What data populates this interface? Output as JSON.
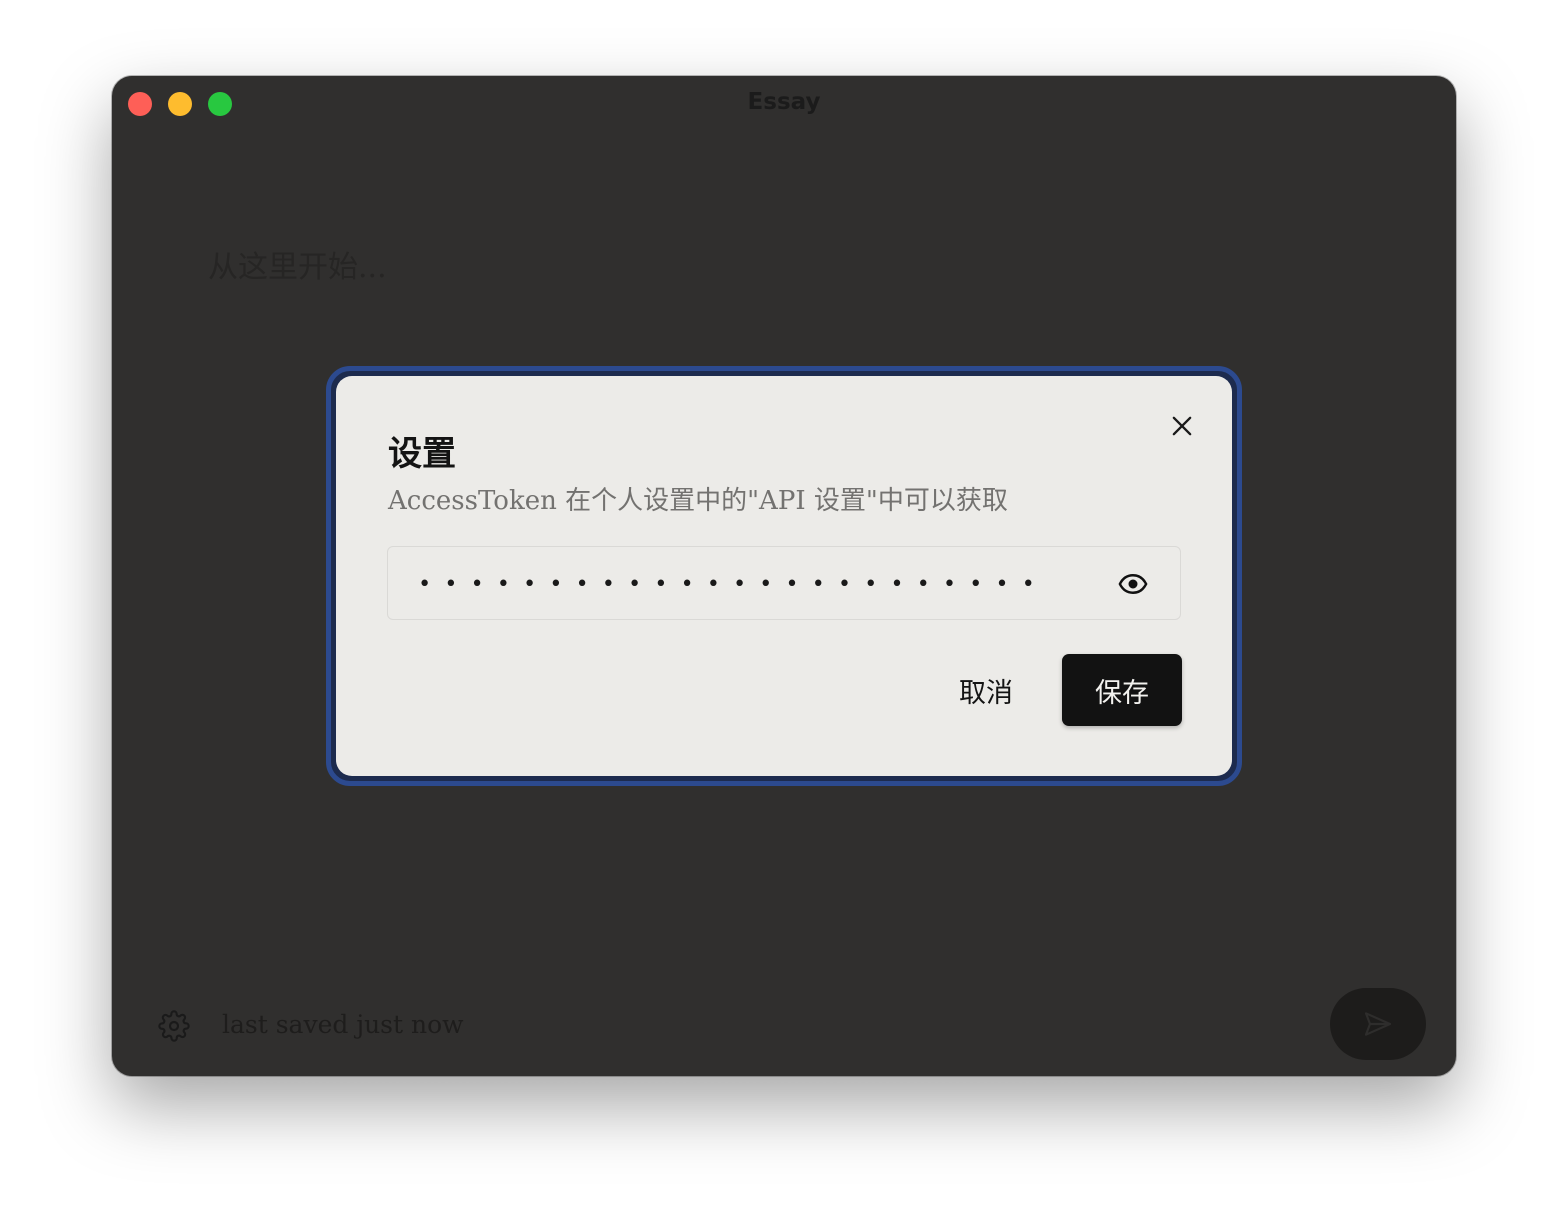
{
  "window": {
    "title": "Essay",
    "traffic_lights": {
      "close": "#fe5f57",
      "minimize": "#febc2e",
      "maximize": "#28c840"
    }
  },
  "editor": {
    "placeholder": "从这里开始..."
  },
  "footer": {
    "settings_icon": "gear-icon",
    "status": "last saved just now",
    "send_icon": "send-icon"
  },
  "dialog": {
    "title": "设置",
    "description": "AccessToken 在个人设置中的\"API 设置\"中可以获取",
    "token_value": "••••••••••••••••••••••••",
    "toggle_icon": "eye-icon",
    "close_icon": "close-icon",
    "cancel_label": "取消",
    "save_label": "保存",
    "focus_ring_color": "#2c4a8f"
  }
}
